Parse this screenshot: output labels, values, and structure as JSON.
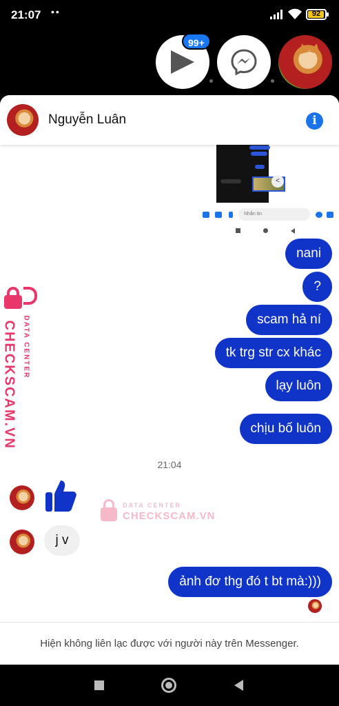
{
  "status_bar": {
    "time": "21:07",
    "notification_dots": "••",
    "battery": "92"
  },
  "chat_heads": {
    "badge": "99+",
    "items": [
      "video-play",
      "messenger",
      "contact-avatar"
    ]
  },
  "conversation": {
    "contact_name": "Nguyễn Luân",
    "shared_image": {
      "input_placeholder": "Nhắn tin"
    },
    "outgoing_messages": [
      "nani",
      "?",
      "scam hả ní",
      "tk trg str cx khác",
      "lạy luôn",
      "chịu bố luôn"
    ],
    "timestamp": "21:04",
    "incoming": {
      "like": "thumbs-up-icon",
      "message": "j v"
    },
    "last_outgoing": "ảnh đơ thg đó t bt mà:)))"
  },
  "watermark": {
    "side_big": "CHECKSCAM.VN",
    "side_small": "DATA CENTER",
    "center_small": "DATA CENTER",
    "center_big": "CHECKSCAM.VN"
  },
  "footer": {
    "notice": "Hiện không liên lạc được với người này trên Messenger."
  },
  "colors": {
    "bubble_outgoing": "#1034c8",
    "bubble_incoming": "#f0f0f0",
    "badge": "#1877f2",
    "watermark": "#e8386b"
  }
}
